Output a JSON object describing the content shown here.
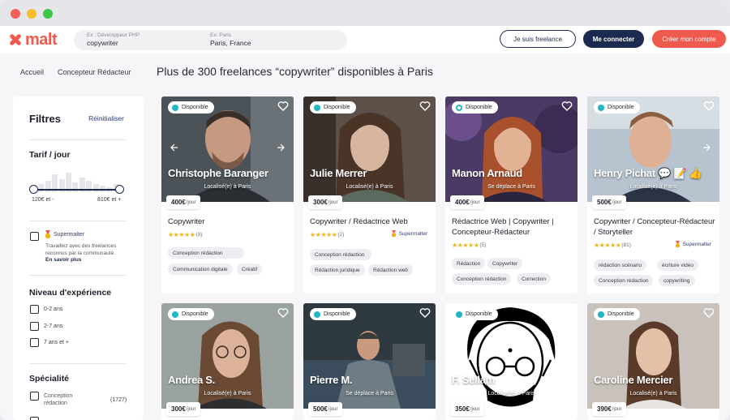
{
  "header": {
    "logo_text": "malt",
    "search_job_label": "Ex : Développeur PHP",
    "search_job_value": "copywriter",
    "search_location_label": "Ex: Paris",
    "search_location_value": "Paris, France",
    "freelance_button": "Je suis freelance",
    "login_button": "Me connecter",
    "signup_button": "Créer mon compte"
  },
  "breadcrumb": [
    "Accueil",
    "Concepteur Rédacteur"
  ],
  "page_title": "Plus de 300 freelances “copywriter” disponibles à Paris",
  "filters": {
    "title": "Filtres",
    "reset": "Réinitialiser",
    "rate_heading": "Tarif / jour",
    "rate_min": "120€ et -",
    "rate_max": "810€ et +",
    "histogram": [
      8,
      10,
      14,
      22,
      16,
      24,
      12,
      18,
      14,
      10,
      8,
      6,
      10
    ],
    "supermalter_label": "Supermalter",
    "supermalter_desc": "Travaillez avec des freelances reconnus par la communauté.",
    "supermalter_link": "En savoir plus",
    "experience_heading": "Niveau d'expérience",
    "experience_options": [
      "0-2 ans",
      "2-7 ans",
      "7 ans et +"
    ],
    "specialty_heading": "Spécialité",
    "specialty_option": "Conception rédaction",
    "specialty_count": "(1727)"
  },
  "badge_label": "Disponible",
  "price_unit": "/jour",
  "supermalter": "Supermalter",
  "cards": [
    {
      "name": "Christophe Baranger",
      "location": "Localisé(e) à Paris",
      "price": "400€",
      "role": "Copywriter",
      "reviews": "(3)",
      "supermalter": false,
      "tags": [
        "Conception rédaction",
        "Communication digitale",
        "Créatif"
      ]
    },
    {
      "name": "Julie Merrer",
      "location": "Localisé(e) à Paris",
      "price": "300€",
      "role": "Copywriter / Rédactrice Web",
      "reviews": "(2)",
      "supermalter": true,
      "tags": [
        "Conception rédaction",
        "Rédaction juridique",
        "Rédaction web"
      ]
    },
    {
      "name": "Manon Arnaud",
      "location": "Se déplace à Paris",
      "price": "400€",
      "role": "Rédactrice Web | Copywriter | Concepteur-Rédacteur",
      "reviews": "(5)",
      "supermalter": false,
      "tags": [
        "Rédaction",
        "Copywriter",
        "Conception rédaction",
        "Correction"
      ]
    },
    {
      "name": "Henry Pichat 💬 📝 👍",
      "location": "Localisé(e) à Paris",
      "price": "500€",
      "role": "Copywriter / Concepteur-Rédacteur / Storyteller",
      "reviews": "(81)",
      "supermalter": true,
      "tags": [
        "rédaction scénario",
        "écriture vidéo",
        "Conception rédaction",
        "copywriting"
      ]
    },
    {
      "name": "Andrea S.",
      "location": "Localisé(e) à Paris",
      "price": "300€"
    },
    {
      "name": "Pierre M.",
      "location": "Se déplace à Paris",
      "price": "500€"
    },
    {
      "name": "F. Sellam",
      "location": "Localisé(e) à Paris",
      "price": "350€"
    },
    {
      "name": "Caroline Mercier",
      "location": "Localisé(e) à Paris",
      "price": "390€"
    }
  ],
  "colors": {
    "brand": "#f0594e",
    "navy": "#1b2a4e",
    "available": "#22b8c3",
    "star": "#f2b311"
  }
}
